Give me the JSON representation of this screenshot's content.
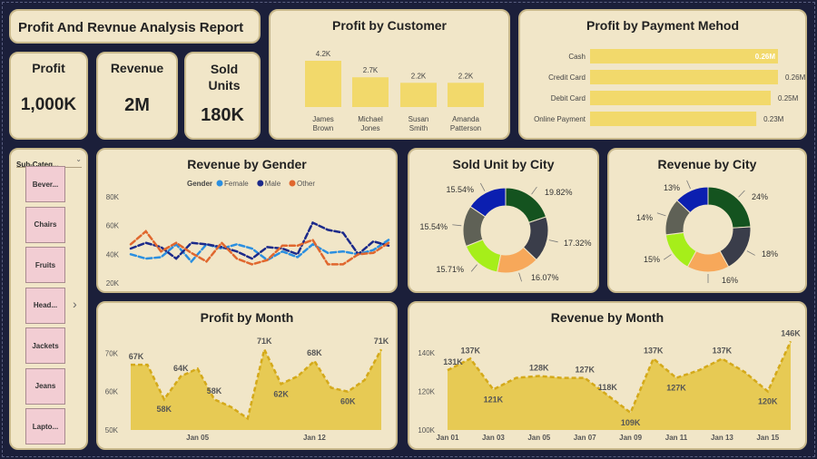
{
  "report_title": "Profit And Revnue Analysis Report",
  "kpis": {
    "profit": {
      "label": "Profit",
      "value": "1,000K"
    },
    "revenue": {
      "label": "Revenue",
      "value": "2M"
    },
    "sold_units": {
      "label": "Sold Units",
      "value": "180K"
    }
  },
  "slicer": {
    "header": "Sub-Categ...",
    "items": [
      "Bever...",
      "Chairs",
      "Fruits",
      "Head...",
      "Jackets",
      "Jeans",
      "Lapto..."
    ]
  },
  "colors": {
    "bar": "#f2d96b",
    "area_fill": "#e6c84e",
    "area_line": "#d4a91a",
    "female": "#2b8fe0",
    "male": "#1c2a8a",
    "other": "#e0672e",
    "donut": [
      "#0b1fb0",
      "#14531f",
      "#3a3d4a",
      "#f7a85a",
      "#a6ee1a",
      "#5f6156"
    ]
  },
  "charts": {
    "profit_by_customer": {
      "title": "Profit by Customer"
    },
    "profit_by_payment": {
      "title": "Profit by Payment Mehod"
    },
    "revenue_by_gender": {
      "title": "Revenue by Gender",
      "legend_title": "Gender"
    },
    "sold_unit_by_city": {
      "title": "Sold Unit by City"
    },
    "revenue_by_city": {
      "title": "Revenue by City"
    },
    "profit_by_month": {
      "title": "Profit by Month"
    },
    "revenue_by_month": {
      "title": "Revenue by Month"
    }
  },
  "chart_data": [
    {
      "id": "profit_by_customer",
      "type": "bar",
      "title": "Profit by Customer",
      "categories": [
        "James Brown",
        "Michael Jones",
        "Susan Smith",
        "Amanda Patterson"
      ],
      "category_lines": [
        [
          "James",
          "Brown"
        ],
        [
          "Michael",
          "Jones"
        ],
        [
          "Susan",
          "Smith"
        ],
        [
          "Amanda",
          "Patterson"
        ]
      ],
      "values": [
        4.2,
        2.7,
        2.2,
        2.2
      ],
      "labels": [
        "4.2K",
        "2.7K",
        "2.2K",
        "2.2K"
      ],
      "unit": "K",
      "ylim": [
        0,
        4.2
      ]
    },
    {
      "id": "profit_by_payment",
      "type": "bar",
      "orientation": "horizontal",
      "title": "Profit by Payment Mehod",
      "categories": [
        "Cash",
        "Credit Card",
        "Debit Card",
        "Online Payment"
      ],
      "values": [
        0.26,
        0.26,
        0.25,
        0.23
      ],
      "labels": [
        "0.26M",
        "0.26M",
        "0.25M",
        "0.23M"
      ],
      "unit": "M"
    },
    {
      "id": "revenue_by_gender",
      "type": "line",
      "title": "Revenue by Gender",
      "legend_title": "Gender",
      "legend_position": "top-left",
      "yticks": [
        "80K",
        "60K",
        "40K",
        "20K"
      ],
      "ylim": [
        20,
        80
      ],
      "series": [
        {
          "name": "Female",
          "values": [
            40,
            37,
            38,
            47,
            35,
            47,
            44,
            47,
            44,
            36,
            42,
            38,
            47,
            41,
            42,
            40,
            43,
            50
          ]
        },
        {
          "name": "Male",
          "values": [
            44,
            48,
            45,
            37,
            48,
            47,
            45,
            42,
            37,
            45,
            44,
            40,
            62,
            57,
            55,
            40,
            49,
            46
          ]
        },
        {
          "name": "Other",
          "values": [
            47,
            56,
            42,
            48,
            41,
            35,
            48,
            37,
            33,
            36,
            46,
            46,
            50,
            33,
            33,
            40,
            41,
            48
          ]
        }
      ]
    },
    {
      "id": "sold_unit_by_city",
      "type": "pie",
      "title": "Sold Unit by City",
      "values": [
        19.82,
        17.32,
        16.07,
        15.71,
        15.54,
        15.54
      ],
      "labels": [
        "19.82%",
        "17.32%",
        "16.07%",
        "15.71%",
        "15.54%",
        "15.54%"
      ]
    },
    {
      "id": "revenue_by_city",
      "type": "pie",
      "title": "Revenue by City",
      "values": [
        24,
        18,
        16,
        15,
        14,
        13
      ],
      "labels": [
        "24%",
        "18%",
        "16%",
        "15%",
        "14%",
        "13%"
      ]
    },
    {
      "id": "profit_by_month",
      "type": "area",
      "title": "Profit by Month",
      "x": [
        "Jan 01",
        "Jan 02",
        "Jan 03",
        "Jan 04",
        "Jan 05",
        "Jan 06",
        "Jan 07",
        "Jan 08",
        "Jan 09",
        "Jan 10",
        "Jan 11",
        "Jan 12",
        "Jan 13",
        "Jan 14",
        "Jan 15",
        "Jan 16"
      ],
      "xticks": [
        "Jan 05",
        "Jan 12"
      ],
      "yticks": [
        "70K",
        "60K",
        "50K"
      ],
      "ylim": [
        50,
        72
      ],
      "values": [
        67,
        67,
        58,
        64,
        66,
        58,
        56,
        53,
        71,
        62,
        64,
        68,
        61,
        60,
        63,
        71
      ],
      "point_labels": {
        "0": "67K",
        "2": "58K",
        "3": "64K",
        "5": "58K",
        "8": "71K",
        "9": "62K",
        "11": "68K",
        "13": "60K",
        "15": "71K"
      }
    },
    {
      "id": "revenue_by_month",
      "type": "area",
      "title": "Revenue by Month",
      "x": [
        "Jan 01",
        "Jan 02",
        "Jan 03",
        "Jan 04",
        "Jan 05",
        "Jan 06",
        "Jan 07",
        "Jan 08",
        "Jan 09",
        "Jan 10",
        "Jan 11",
        "Jan 12",
        "Jan 13",
        "Jan 14",
        "Jan 15",
        "Jan 16"
      ],
      "xticks": [
        "Jan 01",
        "Jan 03",
        "Jan 05",
        "Jan 07",
        "Jan 09",
        "Jan 11",
        "Jan 13",
        "Jan 15"
      ],
      "yticks": [
        "140K",
        "120K",
        "100K"
      ],
      "ylim": [
        100,
        148
      ],
      "values": [
        131,
        137,
        121,
        127,
        128,
        127,
        127,
        118,
        109,
        137,
        127,
        131,
        137,
        130,
        120,
        146
      ],
      "point_labels": {
        "0": "131K",
        "1": "137K",
        "2": "121K",
        "4": "128K",
        "6": "127K",
        "7": "118K",
        "8": "109K",
        "9": "137K",
        "10": "127K",
        "12": "137K",
        "14": "120K",
        "15": "146K"
      }
    }
  ]
}
